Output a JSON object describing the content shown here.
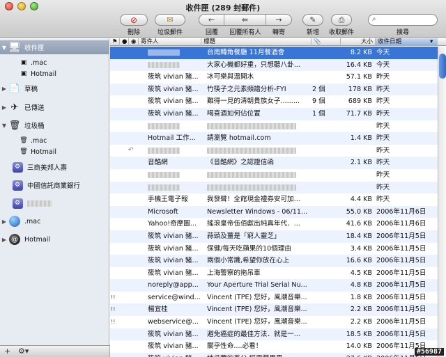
{
  "window": {
    "title": "收件匣 (289 封郵件)"
  },
  "toolbar": {
    "delete_label": "刪除",
    "junk_label": "垃圾郵件",
    "reply_label": "回覆",
    "reply_all_label": "回覆所有人",
    "forward_label": "轉寄",
    "new_label": "新增",
    "get_mail_label": "收取郵件",
    "search_label": "搜尋",
    "search_placeholder": ""
  },
  "sidebar": {
    "inbox": "收件匣",
    "inbox_mac": ".mac",
    "inbox_hotmail": "Hotmail",
    "drafts": "草稿",
    "sent": "已傳送",
    "trash": "垃圾桶",
    "trash_mac": ".mac",
    "trash_hotmail": "Hotmail",
    "folder1": "三商美邦人壽",
    "folder2": "中國信託商業銀行",
    "account_mac": ".mac",
    "account_hotmail": "Hotmail"
  },
  "columns": {
    "from": "寄件人",
    "subject": "標題",
    "size": "大小",
    "date": "收件日期"
  },
  "messages": [
    {
      "flag": "",
      "status": "",
      "from": "",
      "subject": "台南轉角餐廳 11月餐酒會",
      "att": "",
      "size": "8.2 KB",
      "date": "今天"
    },
    {
      "flag": "",
      "status": "",
      "from": "",
      "subject": "大家心機都好重，只想聽八卦...",
      "att": "",
      "size": "16.4 KB",
      "date": "今天"
    },
    {
      "flag": "",
      "status": "",
      "from": "筱筑 vivian 豬...",
      "subject": "冰可樂與溫開水",
      "att": "",
      "size": "57.1 KB",
      "date": "昨天"
    },
    {
      "flag": "",
      "status": "",
      "from": "筱筑 vivian 豬...",
      "subject": "竹筷子之元素頻譜分析-FYI",
      "att": "2 個",
      "size": "178 KB",
      "date": "昨天"
    },
    {
      "flag": "",
      "status": "",
      "from": "筱筑 vivian 豬...",
      "subject": "難得一見的清朝貴族女子.........",
      "att": "9 個",
      "size": "689 KB",
      "date": "昨天"
    },
    {
      "flag": "",
      "status": "",
      "from": "筱筑 vivian 豬...",
      "subject": "喝喜酒如何佔位置",
      "att": "1 個",
      "size": "71.7 KB",
      "date": "昨天"
    },
    {
      "flag": "",
      "status": "",
      "from": "",
      "subject": "",
      "att": "",
      "size": "",
      "date": "昨天"
    },
    {
      "flag": "",
      "status": "",
      "from": "Hotmail 工作...",
      "subject": "請瀏覽 hotmail.com",
      "att": "",
      "size": "1.4 KB",
      "date": "昨天"
    },
    {
      "flag": "",
      "status": "↶",
      "from": "",
      "subject": "",
      "att": "",
      "size": "",
      "date": "昨天"
    },
    {
      "flag": "",
      "status": "",
      "from": "音酷網",
      "subject": "《音酷網》之認證信函",
      "att": "",
      "size": "2.1 KB",
      "date": "昨天"
    },
    {
      "flag": "",
      "status": "",
      "from": "",
      "subject": "",
      "att": "",
      "size": "",
      "date": "昨天"
    },
    {
      "flag": "",
      "status": "",
      "from": "",
      "subject": "",
      "att": "",
      "size": "",
      "date": "昨天"
    },
    {
      "flag": "",
      "status": "",
      "from": "手機王電子報",
      "subject": "我發聲！全館現金禮券安可加...",
      "att": "",
      "size": "4.4 KB",
      "date": "昨天"
    },
    {
      "flag": "",
      "status": "",
      "from": "Microsoft",
      "subject": "Newsletter Windows - 06/11...",
      "att": "",
      "size": "55.0 KB",
      "date": "2006年11月6日"
    },
    {
      "flag": "",
      "status": "",
      "from": "Yahoo!奇摩圖...",
      "subject": "搖滾皇帝伍佰獻出純真年代．...",
      "att": "",
      "size": "41.6 KB",
      "date": "2006年11月6日"
    },
    {
      "flag": "",
      "status": "",
      "from": "筱筑 vivian 豬...",
      "subject": "蒜頭及薑是「窮人靈芝」",
      "att": "",
      "size": "18.4 KB",
      "date": "2006年11月5日"
    },
    {
      "flag": "",
      "status": "",
      "from": "筱筑 vivian 豬...",
      "subject": "保健/每天吃蘋果的10個理由",
      "att": "",
      "size": "3.4 KB",
      "date": "2006年11月5日"
    },
    {
      "flag": "",
      "status": "",
      "from": "筱筑 vivian 豬...",
      "subject": "兩個小常識,希望你放在心上",
      "att": "",
      "size": "16.6 KB",
      "date": "2006年11月5日"
    },
    {
      "flag": "",
      "status": "",
      "from": "筱筑 vivian 豬...",
      "subject": "上海警察的拖吊車",
      "att": "",
      "size": "4.5 KB",
      "date": "2006年11月5日"
    },
    {
      "flag": "",
      "status": "",
      "from": "noreply@app...",
      "subject": "Your Aperture Trial Serial Nu...",
      "att": "",
      "size": "4.8 KB",
      "date": "2006年11月5日"
    },
    {
      "flag": "!!",
      "status": "",
      "from": "service@wind...",
      "subject": "Vincent (TPE) 您好，風潮音樂...",
      "att": "",
      "size": "1.8 KB",
      "date": "2006年11月5日"
    },
    {
      "flag": "!!",
      "status": "",
      "from": "楊宜桂",
      "subject": "Vincent (TPE) 您好，風潮音樂...",
      "att": "",
      "size": "2.2 KB",
      "date": "2006年11月5日"
    },
    {
      "flag": "!!",
      "status": "",
      "from": "webservice@...",
      "subject": "Vincent (TPE) 您好，風潮音樂...",
      "att": "",
      "size": "2.2 KB",
      "date": "2006年11月5日"
    },
    {
      "flag": "",
      "status": "",
      "from": "筱筑 vivian 豬...",
      "subject": "避免癌症的最佳方法．就是一...",
      "att": "",
      "size": "18.5 KB",
      "date": "2006年11月5日"
    },
    {
      "flag": "",
      "status": "",
      "from": "筱筑 vivian 豬...",
      "subject": "關乎性命....必看！",
      "att": "",
      "size": "14.0 KB",
      "date": "2006年11月5日"
    },
    {
      "flag": "",
      "status": "",
      "from": "筱筑 vivian 豬...",
      "subject": "地瓜葉的養分 稱霸蔬果界",
      "att": "",
      "size": "27.6 KB",
      "date": "2006年11月5日"
    }
  ],
  "watermark": "#56987"
}
